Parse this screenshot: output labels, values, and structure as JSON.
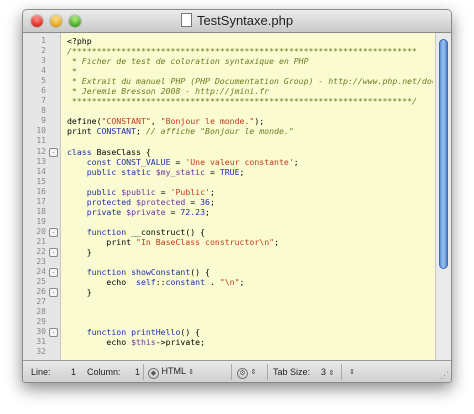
{
  "window": {
    "title": "TestSyntaxe.php"
  },
  "gutter": {
    "lines": [
      {
        "n": "1",
        "fold": ""
      },
      {
        "n": "2",
        "fold": ""
      },
      {
        "n": "3",
        "fold": ""
      },
      {
        "n": "4",
        "fold": ""
      },
      {
        "n": "5",
        "fold": ""
      },
      {
        "n": "6",
        "fold": ""
      },
      {
        "n": "7",
        "fold": ""
      },
      {
        "n": "8",
        "fold": ""
      },
      {
        "n": "9",
        "fold": ""
      },
      {
        "n": "10",
        "fold": ""
      },
      {
        "n": "11",
        "fold": ""
      },
      {
        "n": "12",
        "fold": "-"
      },
      {
        "n": "13",
        "fold": ""
      },
      {
        "n": "14",
        "fold": ""
      },
      {
        "n": "15",
        "fold": ""
      },
      {
        "n": "16",
        "fold": ""
      },
      {
        "n": "17",
        "fold": ""
      },
      {
        "n": "18",
        "fold": ""
      },
      {
        "n": "19",
        "fold": ""
      },
      {
        "n": "20",
        "fold": "-"
      },
      {
        "n": "21",
        "fold": ""
      },
      {
        "n": "22",
        "fold": "-"
      },
      {
        "n": "23",
        "fold": ""
      },
      {
        "n": "24",
        "fold": "-"
      },
      {
        "n": "25",
        "fold": ""
      },
      {
        "n": "26",
        "fold": "-"
      },
      {
        "n": "27",
        "fold": ""
      },
      {
        "n": "28",
        "fold": ""
      },
      {
        "n": "29",
        "fold": ""
      },
      {
        "n": "30",
        "fold": "-"
      },
      {
        "n": "31",
        "fold": ""
      },
      {
        "n": "32",
        "fold": ""
      }
    ]
  },
  "code": {
    "lines": [
      [
        {
          "t": "<?php",
          "c": ""
        }
      ],
      [
        {
          "t": "/**********************************************************************",
          "c": "c-comment"
        }
      ],
      [
        {
          "t": " * Ficher de test de coloration syntaxique en PHP",
          "c": "c-comment"
        }
      ],
      [
        {
          "t": " *",
          "c": "c-comment"
        }
      ],
      [
        {
          "t": " * Extrait du manuel PHP (PHP Documentation Group) - http://www.php.net/docs.php",
          "c": "c-comment"
        }
      ],
      [
        {
          "t": " * Jeremie Bresson 2008 - http://jmini.fr",
          "c": "c-comment"
        }
      ],
      [
        {
          "t": " *********************************************************************/",
          "c": "c-comment"
        }
      ],
      [
        {
          "t": "",
          "c": ""
        }
      ],
      [
        {
          "t": "define(",
          "c": ""
        },
        {
          "t": "\"CONSTANT\"",
          "c": "c-str"
        },
        {
          "t": ", ",
          "c": ""
        },
        {
          "t": "\"Bonjour le monde.\"",
          "c": "c-str"
        },
        {
          "t": ");",
          "c": ""
        }
      ],
      [
        {
          "t": "print ",
          "c": ""
        },
        {
          "t": "CONSTANT",
          "c": "c-const"
        },
        {
          "t": "; ",
          "c": ""
        },
        {
          "t": "// affiche \"Bonjour le monde.\"",
          "c": "c-comment"
        }
      ],
      [
        {
          "t": "",
          "c": ""
        }
      ],
      [
        {
          "t": "class ",
          "c": "c-kw"
        },
        {
          "t": "BaseClass {",
          "c": ""
        }
      ],
      [
        {
          "t": "    const ",
          "c": "c-kw"
        },
        {
          "t": "CONST_VALUE",
          "c": "c-const"
        },
        {
          "t": " = ",
          "c": ""
        },
        {
          "t": "'Une valeur constante'",
          "c": "c-str"
        },
        {
          "t": ";",
          "c": ""
        }
      ],
      [
        {
          "t": "    public static ",
          "c": "c-kw"
        },
        {
          "t": "$my_static",
          "c": "c-var"
        },
        {
          "t": " = ",
          "c": ""
        },
        {
          "t": "TRUE",
          "c": "c-const"
        },
        {
          "t": ";",
          "c": ""
        }
      ],
      [
        {
          "t": "",
          "c": ""
        }
      ],
      [
        {
          "t": "    public ",
          "c": "c-kw"
        },
        {
          "t": "$public",
          "c": "c-var"
        },
        {
          "t": " = ",
          "c": ""
        },
        {
          "t": "'Public'",
          "c": "c-str"
        },
        {
          "t": ";",
          "c": ""
        }
      ],
      [
        {
          "t": "    protected ",
          "c": "c-kw"
        },
        {
          "t": "$protected",
          "c": "c-var"
        },
        {
          "t": " = ",
          "c": ""
        },
        {
          "t": "36",
          "c": "c-num"
        },
        {
          "t": ";",
          "c": ""
        }
      ],
      [
        {
          "t": "    private ",
          "c": "c-kw"
        },
        {
          "t": "$private",
          "c": "c-var"
        },
        {
          "t": " = ",
          "c": ""
        },
        {
          "t": "72.23",
          "c": "c-num"
        },
        {
          "t": ";",
          "c": ""
        }
      ],
      [
        {
          "t": "",
          "c": ""
        }
      ],
      [
        {
          "t": "    function ",
          "c": "c-kw"
        },
        {
          "t": "__construct() {",
          "c": ""
        }
      ],
      [
        {
          "t": "        print ",
          "c": ""
        },
        {
          "t": "\"In ",
          "c": "c-str"
        },
        {
          "t": "BaseClass",
          "c": "c-str c-err"
        },
        {
          "t": " ",
          "c": "c-str"
        },
        {
          "t": "constructor",
          "c": "c-str c-err"
        },
        {
          "t": "\\n\"",
          "c": "c-str"
        },
        {
          "t": ";",
          "c": ""
        }
      ],
      [
        {
          "t": "    }",
          "c": ""
        }
      ],
      [
        {
          "t": "",
          "c": ""
        }
      ],
      [
        {
          "t": "    function ",
          "c": "c-kw"
        },
        {
          "t": "showConstant",
          "c": "c-kw"
        },
        {
          "t": "() {",
          "c": ""
        }
      ],
      [
        {
          "t": "        echo  ",
          "c": ""
        },
        {
          "t": "self",
          "c": "c-kw"
        },
        {
          "t": "::",
          "c": ""
        },
        {
          "t": "constant",
          "c": "c-const"
        },
        {
          "t": " . ",
          "c": ""
        },
        {
          "t": "\"\\n\"",
          "c": "c-str"
        },
        {
          "t": ";",
          "c": ""
        }
      ],
      [
        {
          "t": "    }",
          "c": ""
        }
      ],
      [
        {
          "t": "",
          "c": ""
        }
      ],
      [
        {
          "t": "",
          "c": ""
        }
      ],
      [
        {
          "t": "",
          "c": ""
        }
      ],
      [
        {
          "t": "    function ",
          "c": "c-kw"
        },
        {
          "t": "printHello",
          "c": "c-kw"
        },
        {
          "t": "() {",
          "c": ""
        }
      ],
      [
        {
          "t": "        echo ",
          "c": ""
        },
        {
          "t": "$this",
          "c": "c-var"
        },
        {
          "t": "->private;",
          "c": ""
        }
      ],
      [
        {
          "t": "",
          "c": ""
        }
      ]
    ]
  },
  "statusbar": {
    "line_label": "Line:",
    "line_value": "1",
    "column_label": "Column:",
    "column_value": "1",
    "language": "HTML",
    "tabsize_label": "Tab Size:",
    "tabsize_value": "3"
  },
  "colors": {
    "editor_bg": "#fbfbd2",
    "comment": "#6f7a1f",
    "keyword": "#1d2cb0",
    "string": "#c0391a",
    "variable": "#6a35a8"
  }
}
